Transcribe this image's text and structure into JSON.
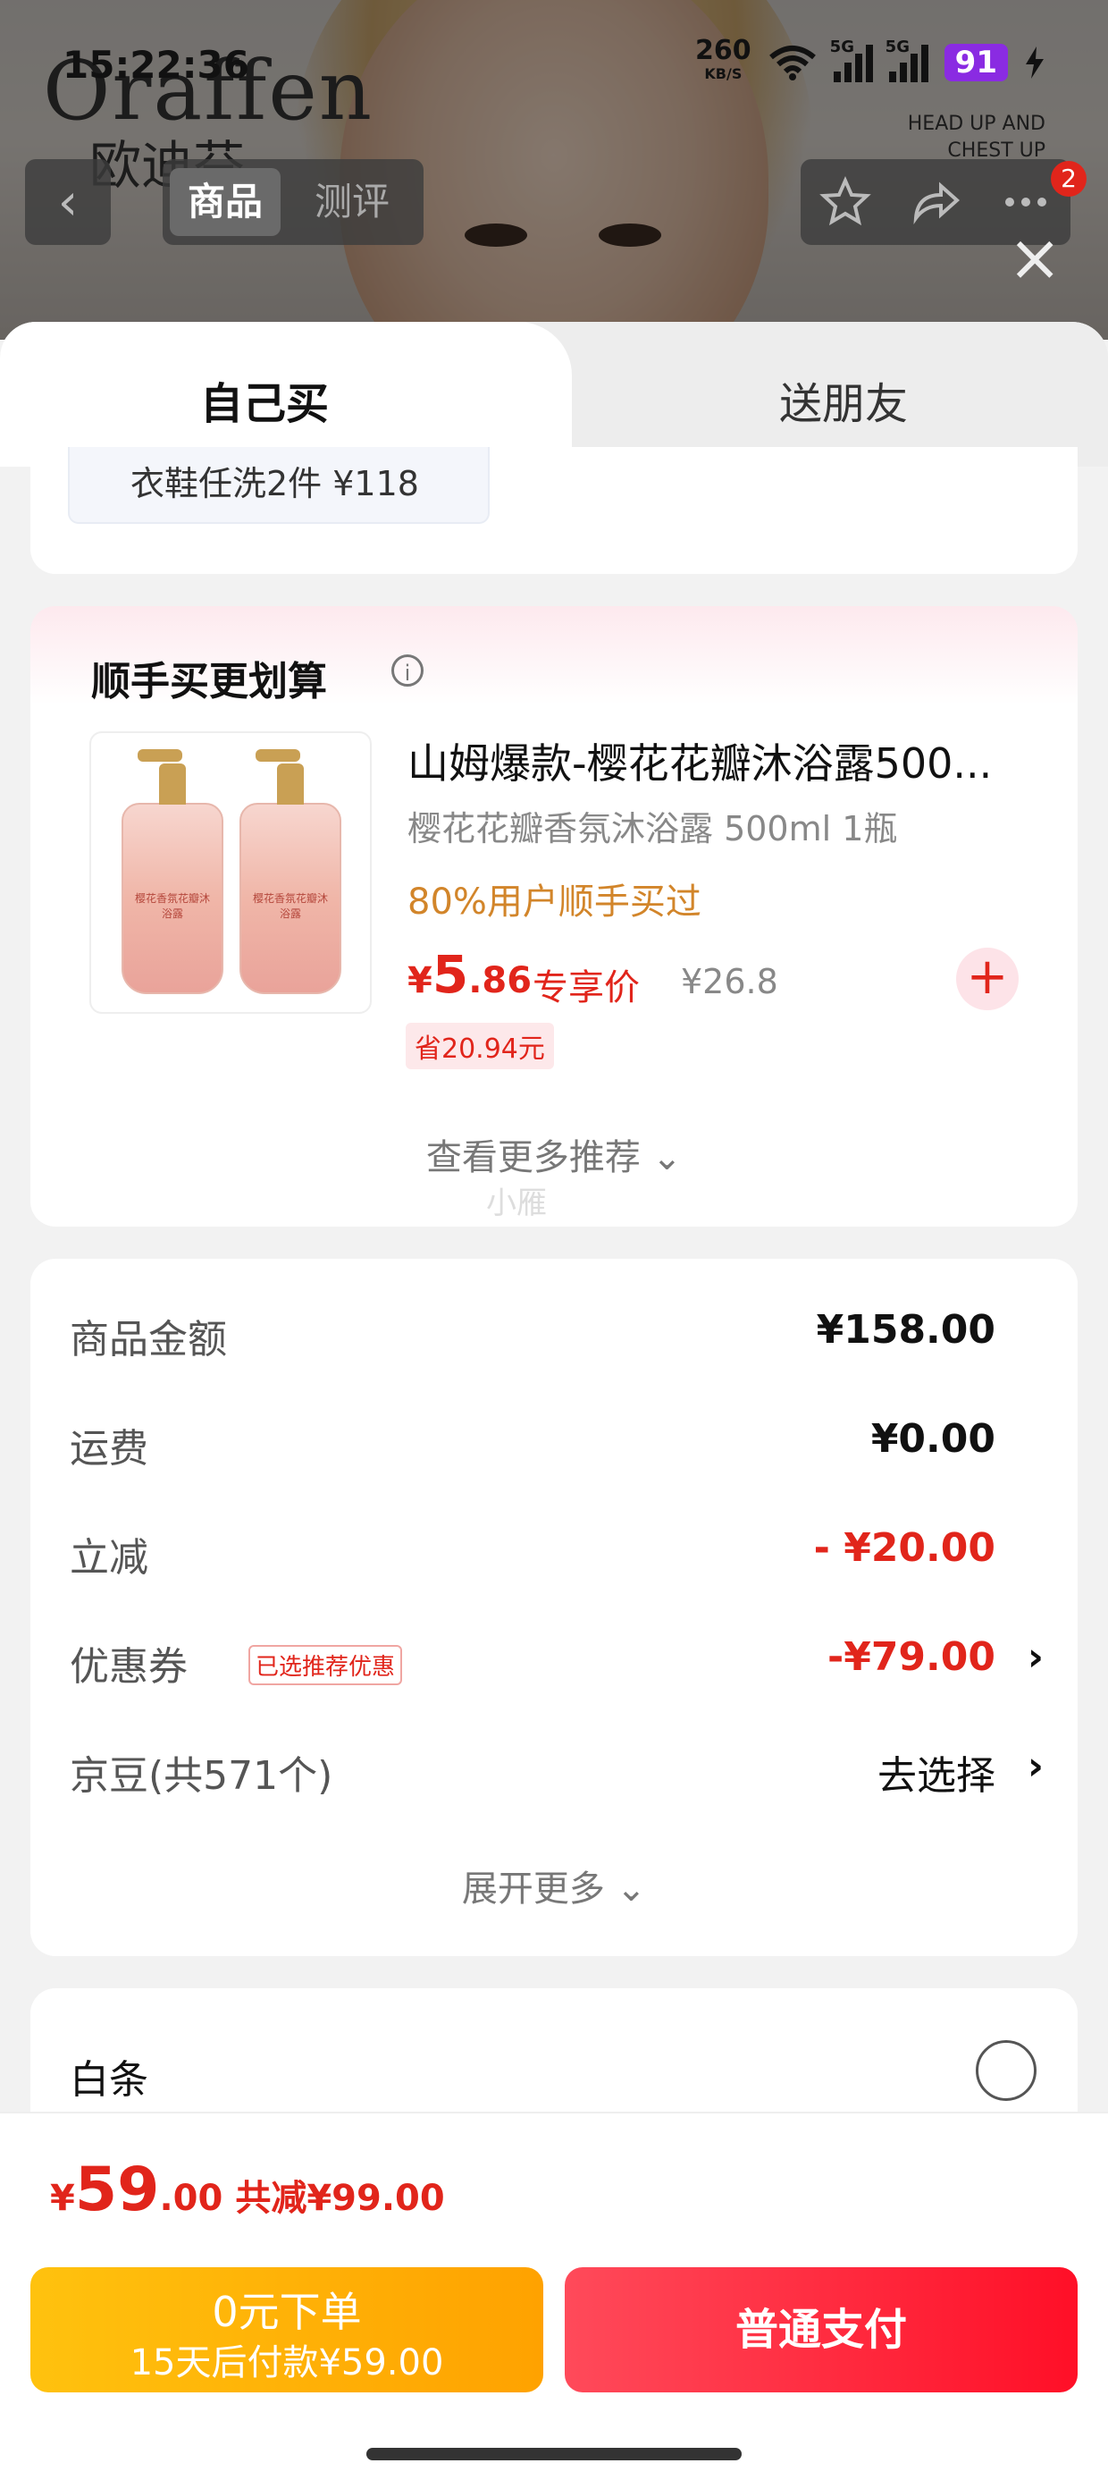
{
  "status_bar": {
    "time": "15:22:36",
    "net_speed": "260",
    "net_unit": "KB/S",
    "sig1_label": "5G",
    "sig2_label": "5G",
    "battery": "91"
  },
  "background": {
    "brand_logo": "Oraffen",
    "brand_cn": "欧迪芬",
    "brand_tag_line1": "HEAD UP AND",
    "brand_tag_line2": "CHEST UP"
  },
  "top_nav": {
    "tab_goods": "商品",
    "tab_review": "测评",
    "badge_count": "2"
  },
  "sheet_tabs": {
    "self": "自己买",
    "friend": "送朋友"
  },
  "prev_chip": "衣鞋任洗2件 ¥118",
  "addon": {
    "title": "顺手买更划算",
    "product_name": "山姆爆款-樱花花瓣沐浴露500...",
    "spec": "樱花花瓣香氛沐浴露 500ml 1瓶",
    "bought_text": "80%用户顺手买过",
    "price_symbol": "¥",
    "price_int": "5",
    "price_dec": ".86",
    "exclusive_label": "专享价",
    "orig_price": "¥26.8",
    "save_text": "省20.94元",
    "bottle_label": "樱花香氛花瓣沐浴露",
    "more_label": "查看更多推荐",
    "watermark": "小雁"
  },
  "summary": {
    "rows": [
      {
        "label": "商品金额",
        "value": "¥158.00"
      },
      {
        "label": "运费",
        "value": "¥0.00"
      },
      {
        "label": "立减",
        "value": "- ¥20.00"
      },
      {
        "label": "优惠券",
        "value": "-¥79.00",
        "tag": "已选推荐优惠"
      },
      {
        "label": "京豆(共571个)",
        "value": "去选择"
      }
    ],
    "expand_label": "展开更多"
  },
  "payment": {
    "baitiao_label": "白条"
  },
  "bottom_bar": {
    "total_symbol": "¥",
    "total_int": "59",
    "total_dec": ".00",
    "total_reduce": "共减¥99.00",
    "zero_btn_line1": "0元下单",
    "zero_btn_line2": "15天后付款¥59.00",
    "pay_btn": "普通支付"
  },
  "colors": {
    "accent_red": "#e1251b",
    "orange_text": "#d2852a",
    "zero_btn": "#ffb000",
    "pay_btn": "#ff2a3d"
  }
}
